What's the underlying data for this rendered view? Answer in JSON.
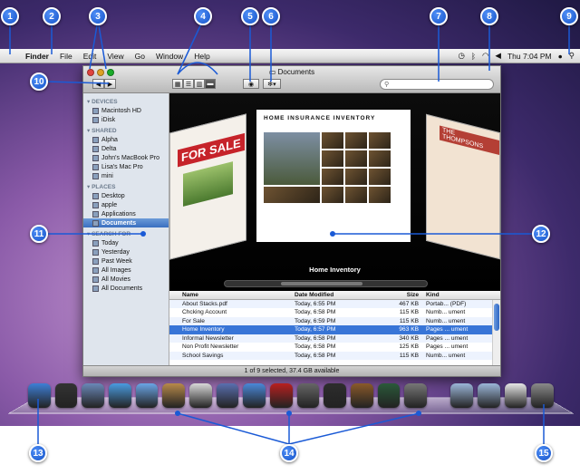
{
  "menubar": {
    "apple_glyph": "",
    "menus": [
      "Finder",
      "File",
      "Edit",
      "View",
      "Go",
      "Window",
      "Help"
    ],
    "clock": "Thu 7:04 PM"
  },
  "window": {
    "title": "Documents",
    "search_placeholder": "",
    "status": "1 of 9 selected, 37.4 GB available"
  },
  "sidebar": {
    "sections": [
      {
        "label": "DEVICES",
        "items": [
          "Macintosh HD",
          "iDisk"
        ]
      },
      {
        "label": "SHARED",
        "items": [
          "Alpha",
          "Delta",
          "John's MacBook Pro",
          "Lisa's Mac Pro",
          "mini"
        ]
      },
      {
        "label": "PLACES",
        "items": [
          "Desktop",
          "apple",
          "Applications",
          "Documents"
        ]
      },
      {
        "label": "SEARCH FOR",
        "items": [
          "Today",
          "Yesterday",
          "Past Week",
          "All Images",
          "All Movies",
          "All Documents"
        ]
      }
    ],
    "selected": "Documents"
  },
  "coverflow": {
    "left_doc_text": "FOR SALE",
    "center_doc_title": "HOME INSURANCE INVENTORY",
    "right_doc_text": "THE THOMPSONS",
    "caption": "Home Inventory"
  },
  "file_list": {
    "columns": [
      "Name",
      "Date Modified",
      "Size",
      "Kind"
    ],
    "rows": [
      {
        "name": "About Stacks.pdf",
        "date": "Today, 6:55 PM",
        "size": "467 KB",
        "kind": "Portab... (PDF)"
      },
      {
        "name": "Chcking Account",
        "date": "Today, 6:58 PM",
        "size": "115 KB",
        "kind": "Numb... ument"
      },
      {
        "name": "For Sale",
        "date": "Today, 6:59 PM",
        "size": "115 KB",
        "kind": "Numb... ument"
      },
      {
        "name": "Home Inventory",
        "date": "Today, 6:57 PM",
        "size": "963 KB",
        "kind": "Pages ... ument"
      },
      {
        "name": "Informal Newsletter",
        "date": "Today, 6:58 PM",
        "size": "340 KB",
        "kind": "Pages ... ument"
      },
      {
        "name": "Non Profit Newsletter",
        "date": "Today, 6:58 PM",
        "size": "125 KB",
        "kind": "Pages ... ument"
      },
      {
        "name": "School Savings",
        "date": "Today, 6:58 PM",
        "size": "115 KB",
        "kind": "Numb... ument"
      }
    ],
    "selected_row": 3
  },
  "dock": {
    "items": [
      {
        "icon": "finder-icon",
        "color": "#3e7fd6"
      },
      {
        "icon": "dashboard-icon",
        "color": "#333333"
      },
      {
        "icon": "mail-icon",
        "color": "#6a88b8"
      },
      {
        "icon": "safari-icon",
        "color": "#4a9be0"
      },
      {
        "icon": "ichat-icon",
        "color": "#6aa5e6"
      },
      {
        "icon": "address-book-icon",
        "color": "#b88a4a"
      },
      {
        "icon": "ical-icon",
        "color": "#d8d8d8"
      },
      {
        "icon": "preview-icon",
        "color": "#5a6fb0"
      },
      {
        "icon": "itunes-icon",
        "color": "#4a88d8"
      },
      {
        "icon": "photo-booth-icon",
        "color": "#b82020"
      },
      {
        "icon": "iphoto-icon",
        "color": "#666666"
      },
      {
        "icon": "imovie-icon",
        "color": "#2d2d2d"
      },
      {
        "icon": "garageband-icon",
        "color": "#8a5a2a"
      },
      {
        "icon": "time-machine-icon",
        "color": "#2a5a3a"
      },
      {
        "icon": "system-preferences-icon",
        "color": "#777777"
      },
      {
        "icon": "separator",
        "color": ""
      },
      {
        "icon": "applications-folder-icon",
        "color": "#9bb6d8"
      },
      {
        "icon": "documents-folder-icon",
        "color": "#9bb6d8"
      },
      {
        "icon": "downloads-stack-icon",
        "color": "#e6e6e6"
      },
      {
        "icon": "trash-icon",
        "color": "#8a8a8a"
      }
    ]
  },
  "callouts": [
    "1",
    "2",
    "3",
    "4",
    "5",
    "6",
    "7",
    "8",
    "9",
    "10",
    "11",
    "12",
    "13",
    "14",
    "15"
  ],
  "colors": {
    "callout_blue": "#1553c8",
    "selection_blue": "#3875d7"
  }
}
